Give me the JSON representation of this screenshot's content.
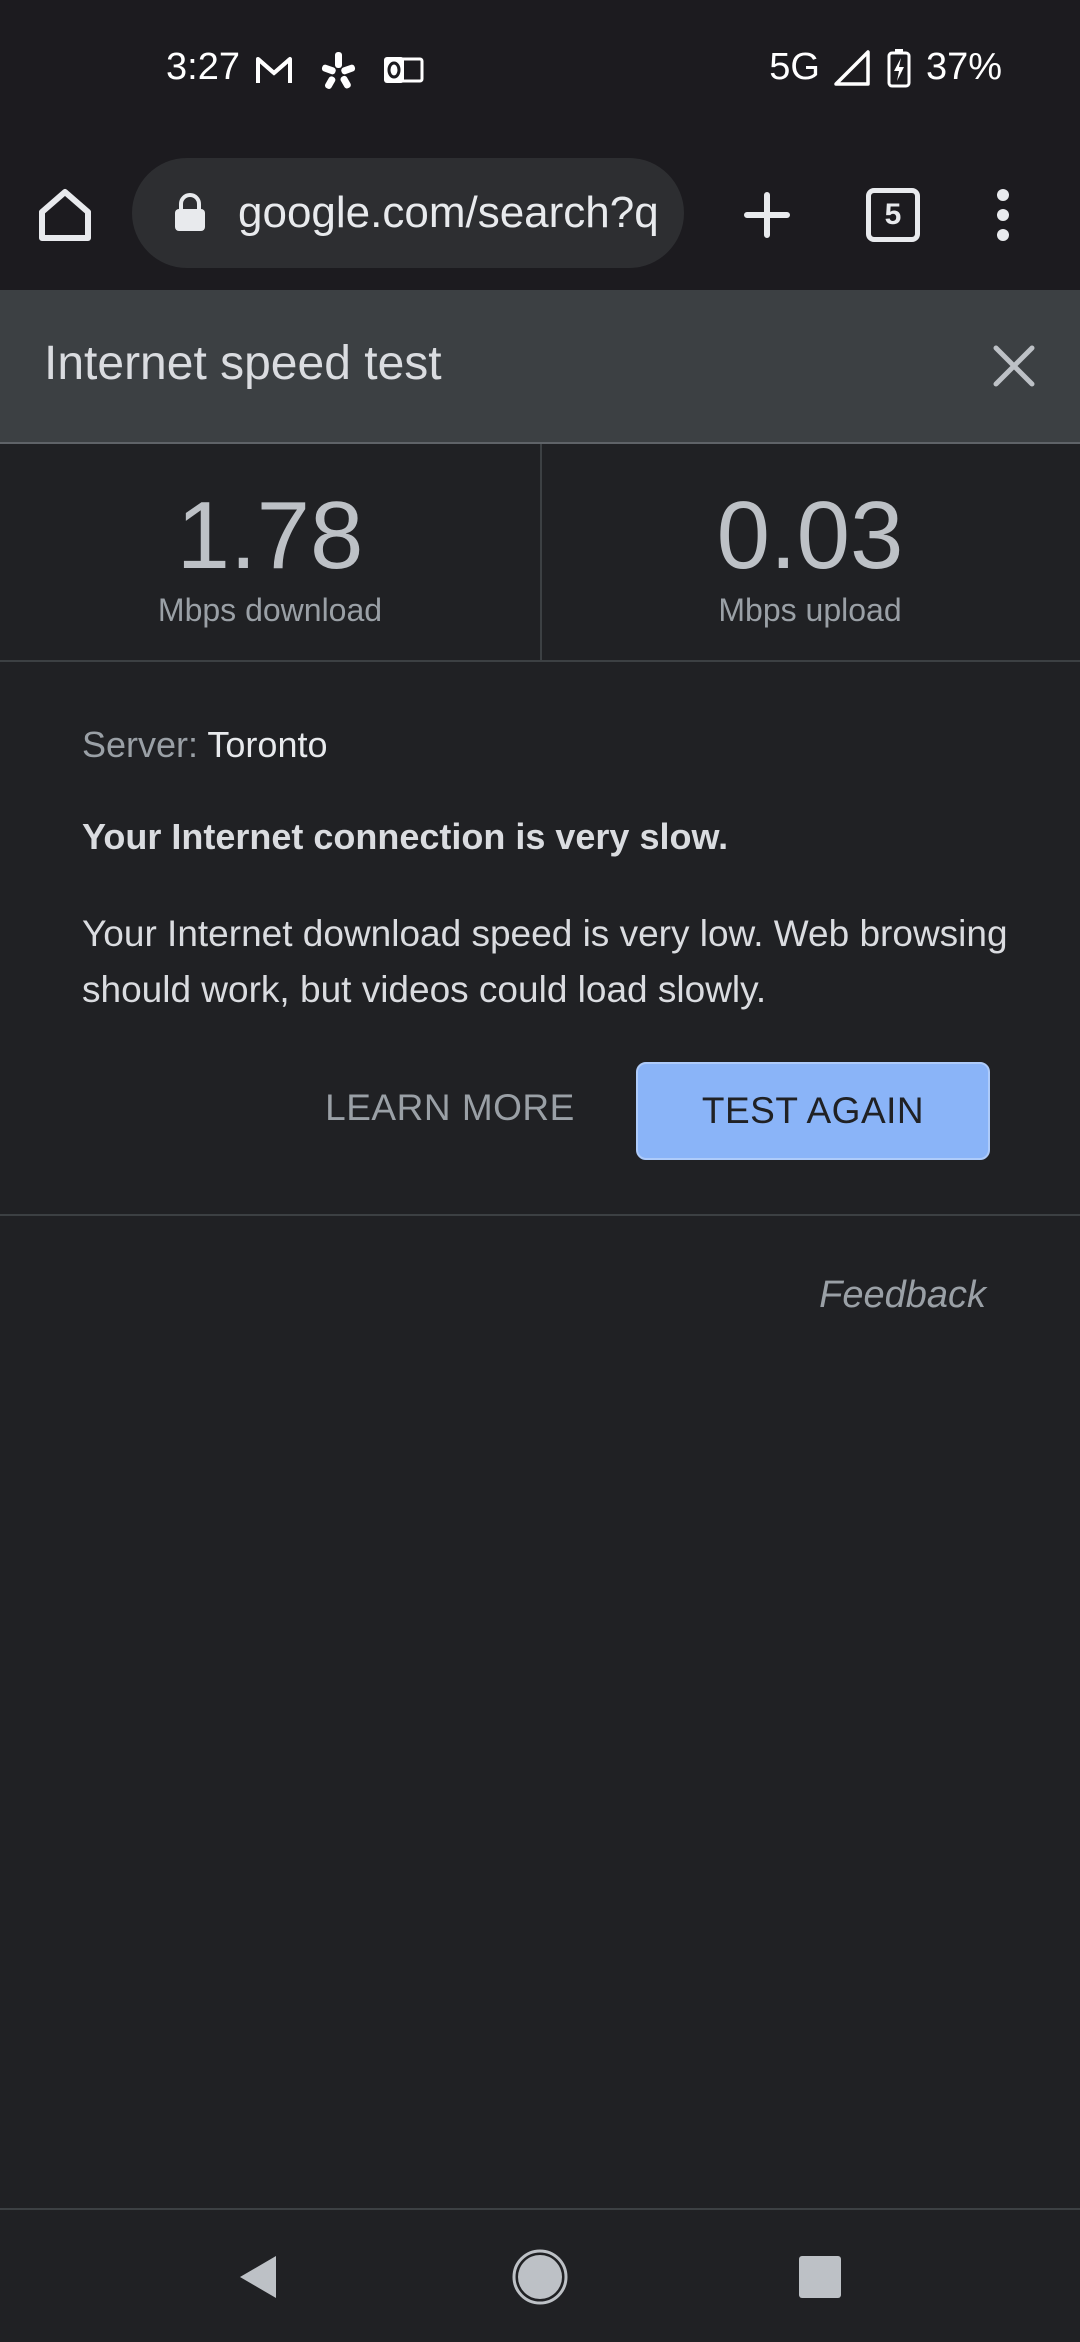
{
  "status_bar": {
    "time": "3:27",
    "network": "5G",
    "battery": "37%",
    "icons_left": [
      "gmail-icon",
      "yelp-icon",
      "outlook-icon"
    ],
    "icons_right": [
      "signal-icon",
      "battery-charging-icon"
    ]
  },
  "toolbar": {
    "url": "google.com/search?q",
    "tab_count": "5",
    "icons": [
      "home-icon",
      "lock-icon",
      "plus-icon",
      "tabs-icon",
      "more-vert-icon"
    ]
  },
  "speed_test": {
    "title": "Internet speed test",
    "download_value": "1.78",
    "download_label": "Mbps download",
    "upload_value": "0.03",
    "upload_label": "Mbps upload",
    "server_label": "Server:",
    "server_value": "Toronto",
    "verdict": "Your Internet connection is very slow.",
    "description": "Your Internet download speed is very low. Web browsing should work, but videos could load slowly.",
    "learn_more": "LEARN MORE",
    "test_again": "TEST AGAIN",
    "feedback": "Feedback"
  },
  "colors": {
    "background": "#202124",
    "header": "#3c4043",
    "accent_button": "#8ab4f8"
  },
  "nav_bar": {
    "icons": [
      "back-icon",
      "home-circle-icon",
      "recents-icon"
    ]
  }
}
